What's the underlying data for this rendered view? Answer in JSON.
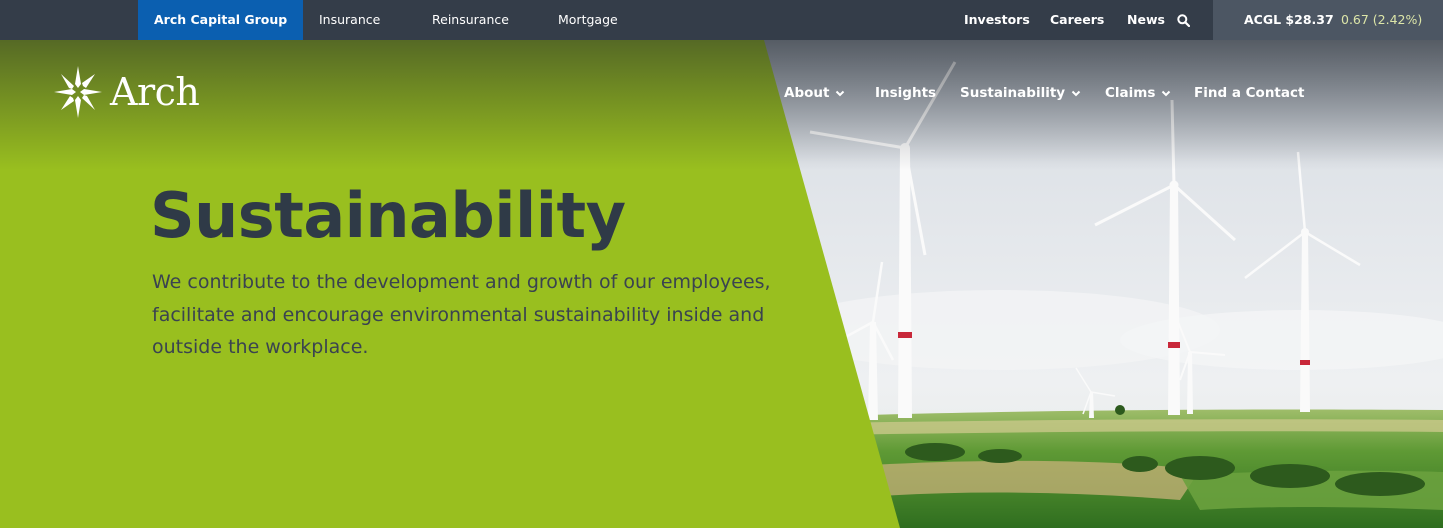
{
  "topbar": {
    "brand_link": "Arch Capital Group",
    "links": [
      "Insurance",
      "Reinsurance",
      "Mortgage"
    ],
    "right_links": [
      "Investors",
      "Careers",
      "News"
    ],
    "search_icon": "search-icon",
    "ticker": {
      "symbol_price": "ACGL $28.37",
      "change": "0.67 (2.42%)"
    },
    "colors": {
      "bar": "#343d49",
      "active": "#0b5fb0",
      "ticker_bg": "#4c5663",
      "ticker_change": "#dce5a8"
    }
  },
  "header": {
    "logo_text": "Arch",
    "logo_icon": "star-compass-icon",
    "nav": [
      {
        "label": "About",
        "has_dropdown": true
      },
      {
        "label": "Insights",
        "has_dropdown": false
      },
      {
        "label": "Sustainability",
        "has_dropdown": true
      },
      {
        "label": "Claims",
        "has_dropdown": true
      },
      {
        "label": "Find a Contact",
        "has_dropdown": false
      }
    ]
  },
  "hero": {
    "title": "Sustainability",
    "description": "We contribute to the development and growth of our employees, facilitate and encourage environmental sustainability inside and outside the workplace.",
    "colors": {
      "panel": "#99bf1f",
      "title": "#2f3a47"
    }
  }
}
